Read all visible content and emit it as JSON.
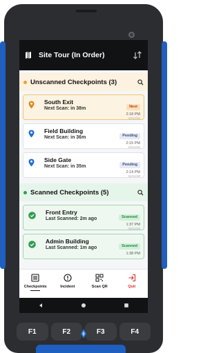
{
  "header": {
    "title": "Site Tour (In Order)"
  },
  "unscanned": {
    "title": "Unscanned Checkpoints (3)",
    "items": [
      {
        "name": "South Exit",
        "sub": "Next Scan: in 38m",
        "badge": "Next",
        "time": "2:18 PM",
        "date": "03/12/26"
      },
      {
        "name": "Field Building",
        "sub": "Next Scan: in 36m",
        "badge": "Pending",
        "time": "2:15 PM",
        "date": "03/12/26"
      },
      {
        "name": "Side Gate",
        "sub": "Next Scan: in 35m",
        "badge": "Pending",
        "time": "2:14 PM",
        "date": "03/12/26"
      }
    ]
  },
  "scanned": {
    "title": "Scanned Checkpoints (5)",
    "items": [
      {
        "name": "Front Entry",
        "sub": "Last Scanned: 2m ago",
        "badge": "Scanned",
        "time": "1:37 PM",
        "date": "03/12/26"
      },
      {
        "name": "Admin Building",
        "sub": "Last Scanned: 1m ago",
        "badge": "Scanned",
        "time": "1:38 PM",
        "date": ""
      }
    ]
  },
  "nav": {
    "checkpoints": "Checkpoints",
    "incident": "Incident",
    "scan_qr": "Scan QR",
    "quit": "Quit"
  },
  "fkeys": [
    "F1",
    "F2",
    "F3",
    "F4"
  ],
  "colors": {
    "accent_orange": "#f0a030",
    "accent_green": "#2e9e4f",
    "pin_blue": "#1f6fd1",
    "quit_red": "#d32f2f"
  }
}
